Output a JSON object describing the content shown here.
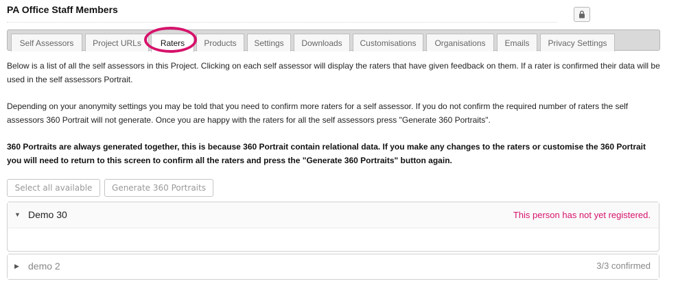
{
  "page": {
    "title": "PA Office Staff Members"
  },
  "tabs": [
    {
      "label": "Self Assessors"
    },
    {
      "label": "Project URLs"
    },
    {
      "label": "Raters",
      "active": true
    },
    {
      "label": "Products"
    },
    {
      "label": "Settings"
    },
    {
      "label": "Downloads"
    },
    {
      "label": "Customisations"
    },
    {
      "label": "Organisations"
    },
    {
      "label": "Emails"
    },
    {
      "label": "Privacy Settings"
    }
  ],
  "intro": {
    "p1": "Below is a list of all the self assessors in this Project. Clicking on each self assessor will display the raters that have given feedback on them. If a rater is confirmed their data will be used in the self assessors Portrait.",
    "p2": "Depending on your anonymity settings you may be told that you need to confirm more raters for a self assessor. If you do not confirm the required number of raters the self assessors 360 Portrait will not generate. Once you are happy with the raters for all the self assessors press \"Generate 360 Portraits\".",
    "p3": "360 Portraits are always generated together, this is because 360 Portrait contain relational data. If you make any changes to the raters or customise the 360 Portrait you will need to return to this screen to confirm all the raters and press the \"Generate 360 Portraits\" button again."
  },
  "actions": {
    "select_all": "Select all available",
    "generate": "Generate 360 Portraits"
  },
  "assessors": [
    {
      "name": "Demo 30",
      "status": "This person has not yet registered.",
      "expanded": true,
      "status_color": "#d6136b"
    },
    {
      "name": "demo 2",
      "status": "3/3 confirmed",
      "expanded": false,
      "status_color": "#888888"
    }
  ],
  "colors": {
    "accent": "#d6136b"
  },
  "icons": {
    "lock": "lock-icon",
    "expanded": "caret-down-icon",
    "collapsed": "caret-right-icon"
  }
}
